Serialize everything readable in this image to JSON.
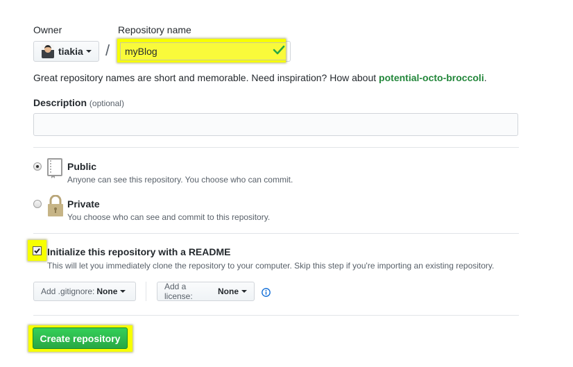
{
  "owner": {
    "label": "Owner",
    "name": "tiakia"
  },
  "repository": {
    "label": "Repository name",
    "value": "myBlog",
    "separator": "/"
  },
  "hint": {
    "text": "Great repository names are short and memorable. Need inspiration? How about ",
    "suggestion": "potential-octo-broccoli",
    "end": "."
  },
  "description": {
    "label": "Description",
    "optional": "(optional)",
    "value": ""
  },
  "visibility": {
    "selected": "public",
    "public": {
      "title": "Public",
      "desc": "Anyone can see this repository. You choose who can commit."
    },
    "private": {
      "title": "Private",
      "desc": "You choose who can see and commit to this repository."
    }
  },
  "readme": {
    "checked": true,
    "title": "Initialize this repository with a README",
    "desc": "This will let you immediately clone the repository to your computer. Skip this step if you're importing an existing repository."
  },
  "gitignore": {
    "label": "Add .gitignore:",
    "value": "None"
  },
  "license": {
    "label": "Add a license:",
    "value": "None"
  },
  "create_button": "Create repository",
  "colors": {
    "highlight": "#f7ff00",
    "success": "#28a745",
    "suggestion": "#22863a"
  },
  "icons": [
    "chevron-down-icon",
    "check-icon",
    "repo-book-icon",
    "lock-icon",
    "info-icon",
    "checkbox-check-icon"
  ]
}
